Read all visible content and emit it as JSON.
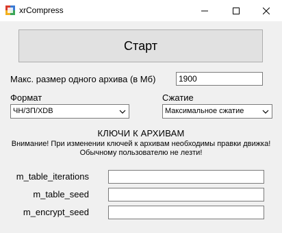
{
  "window": {
    "title": "xrCompress",
    "icon": "app-icon"
  },
  "main": {
    "start_button": "Старт",
    "max_size_label": "Макс. размер одного архива (в Мб)",
    "max_size_value": "1900",
    "format_label": "Формат",
    "format_value": "ЧН/ЗП/XDB",
    "compression_label": "Сжатие",
    "compression_value": "Максимальное сжатие",
    "keys_header": "КЛЮЧИ К АРХИВАМ",
    "warning_line1": "Внимание! При изменении ключей к архивам необходимы правки движка!",
    "warning_line2": "Обычному пользователю не лезти!",
    "keys": [
      {
        "label": "m_table_iterations",
        "value": ""
      },
      {
        "label": "m_table_seed",
        "value": ""
      },
      {
        "label": "m_encrypt_seed",
        "value": ""
      }
    ]
  },
  "colors": {
    "window_bg": "#f0f0f0",
    "titlebar_bg": "#ffffff",
    "button_bg": "#e1e1e1",
    "border": "#7a7a7a"
  }
}
